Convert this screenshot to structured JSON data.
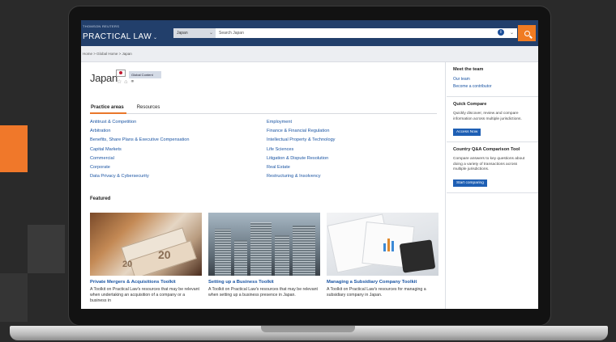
{
  "header": {
    "brand_small": "THOMSON REUTERS",
    "brand_main": "PRACTICAL LAW",
    "jurisdiction": "Japan",
    "search_placeholder": "Search Japan"
  },
  "breadcrumb": "Home > Global Home > Japan",
  "page": {
    "title": "Japan",
    "badge": "Global Content"
  },
  "tabs": [
    {
      "label": "Practice areas",
      "active": true
    },
    {
      "label": "Resources",
      "active": false
    }
  ],
  "practice_areas": {
    "left": [
      "Antitrust & Competition",
      "Arbitration",
      "Benefits, Share Plans & Executive Compensation",
      "Capital Markets",
      "Commercial",
      "Corporate",
      "Data Privacy & Cybersecurity"
    ],
    "right": [
      "Employment",
      "Finance & Financial Regulation",
      "Intellectual Property & Technology",
      "Life Sciences",
      "Litigation & Dispute Resolution",
      "Real Estate",
      "Restructuring & Insolvency"
    ]
  },
  "featured": {
    "label": "Featured",
    "cards": [
      {
        "title": "Private Mergers & Acquisitions Toolkit",
        "desc": "A Toolkit on Practical Law's resources that may be relevant when undertaking an acquisition of a company or a business in"
      },
      {
        "title": "Setting up a Business Toolkit",
        "desc": "A Toolkit on Practical Law's resources that may be relevant when setting up a business presence in Japan."
      },
      {
        "title": "Managing a Subsidiary Company Toolkit",
        "desc": "A Toolkit on Practical Law's resources for managing a subsidiary company in Japan."
      }
    ]
  },
  "sidebar": {
    "meet": {
      "heading": "Meet the team",
      "link1": "Our team",
      "link2": "Become a contributor"
    },
    "quick": {
      "heading": "Quick Compare",
      "text": "Quickly discover, review and compare information across multiple jurisdictions.",
      "button": "Access Now"
    },
    "country": {
      "heading": "Country Q&A Comparison Tool",
      "text": "Compare answers to key questions about doing a variety of transactions across multiple jurisdictions.",
      "button": "Start comparing"
    }
  },
  "colors": {
    "header": "#223f6b",
    "accent": "#f07b22",
    "link": "#1b55a3"
  }
}
